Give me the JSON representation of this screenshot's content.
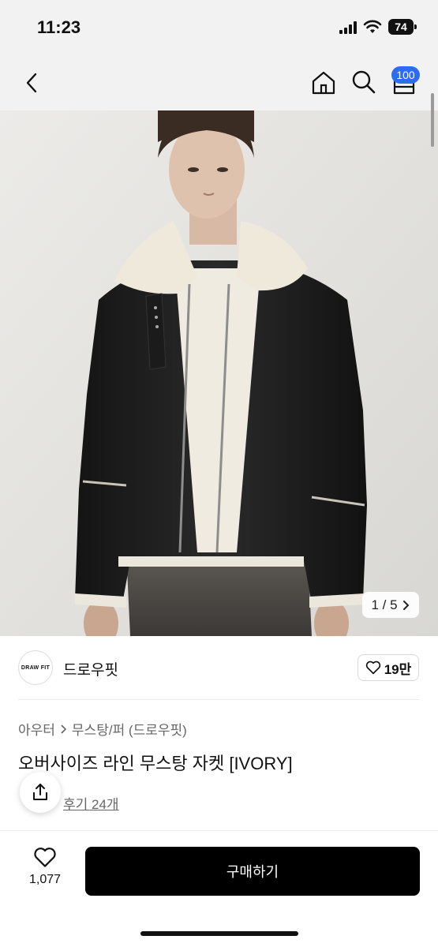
{
  "status_bar": {
    "time": "11:23",
    "battery": "74"
  },
  "nav": {
    "cart_badge": "100"
  },
  "gallery": {
    "counter": "1 / 5"
  },
  "brand": {
    "logo_text": "DRAW FIT",
    "name": "드로우핏",
    "likes": "19만"
  },
  "breadcrumb": {
    "level1": "아우터",
    "level2": "무스탕/퍼 (드로우핏)"
  },
  "product": {
    "title": "오버사이즈 라인 무스탕 자켓 [IVORY]",
    "reviews": "후기 24개"
  },
  "bottom": {
    "wish_count": "1,077",
    "buy_label": "구매하기"
  },
  "colors": {
    "badge": "#2f6bef",
    "buy_button": "#000000"
  },
  "icons": [
    "back-icon",
    "home-icon",
    "search-icon",
    "cart-icon",
    "heart-icon",
    "share-icon",
    "chevron-right-icon"
  ]
}
